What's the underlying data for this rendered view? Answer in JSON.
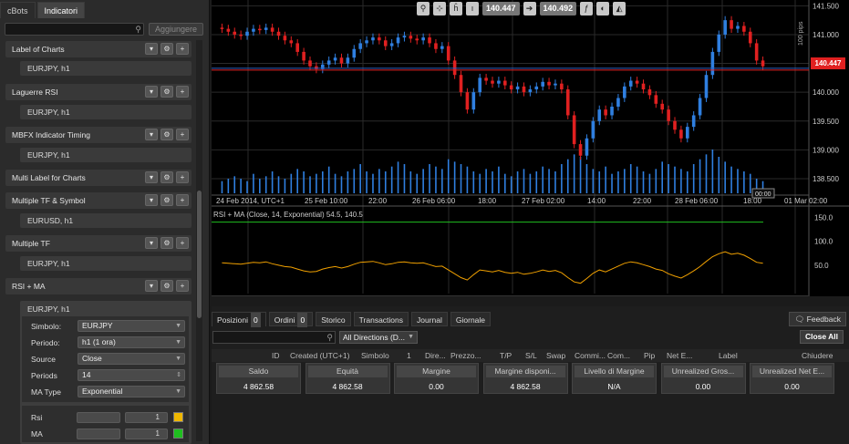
{
  "left_panel": {
    "tabs": [
      "cBots",
      "Indicatori"
    ],
    "add_label": "Aggiungere",
    "indicators": [
      {
        "name": "Label of Charts",
        "sub": "EURJPY, h1"
      },
      {
        "name": "Laguerre RSI",
        "sub": "EURJPY, h1"
      },
      {
        "name": "MBFX  Indicator Timing",
        "sub": "EURJPY, h1"
      },
      {
        "name": "Multi Label for Charts",
        "sub": ""
      },
      {
        "name": "Multiple TF & Symbol",
        "sub": "EURUSD, h1"
      },
      {
        "name": "Multiple TF",
        "sub": "EURJPY, h1"
      },
      {
        "name": "RSI + MA",
        "sub": "EURJPY, h1"
      }
    ],
    "params": {
      "simbolo_label": "Simbolo:",
      "simbolo_value": "EURJPY",
      "periodo_label": "Periodo:",
      "periodo_value": "h1 (1 ora)",
      "source_label": "Source",
      "source_value": "Close",
      "periods_label": "Periods",
      "periods_value": "14",
      "matype_label": "MA Type",
      "matype_value": "Exponential"
    },
    "lines": {
      "rsi_label": "Rsi",
      "rsi_width": "1",
      "rsi_color": "#f0b800",
      "ma_label": "MA",
      "ma_width": "1",
      "ma_color": "#1fbf1f"
    }
  },
  "chart": {
    "bid": "140.447",
    "ask": "140.492",
    "price_badge": "140.447",
    "pips_label": "100 pips",
    "price_ticks": [
      "141.500",
      "141.000",
      "140.500",
      "140.000",
      "139.500",
      "139.000",
      "138.500"
    ],
    "time_labels": [
      "24 Feb 2014, UTC+1",
      "25 Feb 10:00",
      "22:00",
      "26 Feb 06:00",
      "18:00",
      "27 Feb 02:00",
      "14:00",
      "22:00",
      "28 Feb 06:00",
      "18:00",
      "01 Mar 02:00"
    ],
    "cursor_time": "00:00",
    "rsi_title": "RSI + MA (Close, 14, Exponential) 54.5, 140.5",
    "rsi_ticks": [
      "150.0",
      "100.0",
      "50.0"
    ],
    "colors": {
      "bull": "#2f7fe0",
      "bear": "#e02020",
      "rsi": "#f0a000",
      "ma": "#1fbf1f"
    }
  },
  "bottom": {
    "tabs": [
      {
        "label": "Posizioni",
        "count": "0"
      },
      {
        "label": "Ordini",
        "count": "0"
      },
      {
        "label": "Storico",
        "count": ""
      },
      {
        "label": "Transactions",
        "count": ""
      },
      {
        "label": "Journal",
        "count": ""
      },
      {
        "label": "Giornale",
        "count": ""
      }
    ],
    "feedback": "Feedback",
    "direction": "All Directions (D...",
    "close_all": "Close All",
    "columns": [
      "ID",
      "Created (UTC+1)",
      "Simbolo",
      "1",
      "Dire...",
      "Prezzo...",
      "T/P",
      "S/L",
      "Swap",
      "Commi...",
      "Com...",
      "Pip",
      "Net E...",
      "Label",
      "Chiudere"
    ],
    "cards": [
      {
        "title": "Saldo",
        "value": "4 862.58"
      },
      {
        "title": "Equità",
        "value": "4 862.58"
      },
      {
        "title": "Margine",
        "value": "0.00"
      },
      {
        "title": "Margine disponi...",
        "value": "4 862.58"
      },
      {
        "title": "Livello di Margine",
        "value": "N/A"
      },
      {
        "title": "Unrealized Gros...",
        "value": "0.00"
      },
      {
        "title": "Unrealized Net E...",
        "value": "0.00"
      }
    ]
  },
  "chart_data": {
    "type": "candlestick",
    "y_range": [
      138.2,
      141.6
    ],
    "close": [
      141.1,
      141.05,
      141.0,
      140.98,
      141.05,
      141.1,
      141.08,
      141.12,
      141.05,
      140.98,
      140.9,
      140.85,
      140.7,
      140.55,
      140.45,
      140.4,
      140.48,
      140.55,
      140.6,
      140.5,
      140.6,
      140.75,
      140.85,
      140.9,
      140.95,
      140.9,
      140.8,
      140.85,
      140.95,
      140.98,
      140.93,
      140.9,
      140.95,
      140.85,
      140.75,
      140.8,
      140.55,
      140.3,
      140.0,
      139.7,
      140.0,
      140.25,
      140.2,
      140.15,
      140.2,
      140.12,
      140.05,
      140.1,
      140.0,
      140.05,
      140.1,
      140.18,
      140.12,
      140.15,
      140.05,
      139.6,
      139.1,
      138.9,
      139.2,
      139.5,
      139.7,
      139.6,
      139.75,
      139.9,
      140.1,
      140.2,
      140.15,
      140.05,
      139.95,
      139.8,
      139.7,
      139.5,
      139.35,
      139.2,
      139.4,
      139.6,
      139.9,
      140.3,
      140.7,
      141.0,
      141.25,
      141.1,
      141.15,
      141.05,
      140.85,
      140.55,
      140.45
    ],
    "volume": [
      5,
      6,
      7,
      6,
      5,
      8,
      6,
      7,
      9,
      7,
      6,
      8,
      10,
      9,
      7,
      8,
      9,
      11,
      8,
      7,
      9,
      10,
      12,
      9,
      8,
      10,
      9,
      11,
      13,
      12,
      9,
      8,
      10,
      12,
      11,
      10,
      14,
      13,
      12,
      11,
      9,
      8,
      10,
      9,
      11,
      8,
      7,
      9,
      10,
      8,
      9,
      11,
      10,
      9,
      12,
      14,
      16,
      15,
      12,
      10,
      9,
      11,
      8,
      9,
      10,
      12,
      11,
      9,
      8,
      10,
      13,
      12,
      11,
      10,
      9,
      12,
      14,
      16,
      18,
      15,
      13,
      11,
      10,
      9,
      8,
      6,
      5
    ],
    "rsi": [
      55,
      54,
      53,
      52,
      54,
      56,
      55,
      57,
      53,
      50,
      47,
      46,
      42,
      38,
      36,
      37,
      42,
      45,
      47,
      44,
      47,
      52,
      56,
      57,
      58,
      55,
      51,
      53,
      56,
      57,
      55,
      54,
      55,
      51,
      47,
      48,
      40,
      32,
      24,
      19,
      30,
      40,
      38,
      36,
      39,
      35,
      33,
      35,
      31,
      33,
      36,
      40,
      37,
      39,
      34,
      24,
      15,
      12,
      22,
      33,
      40,
      36,
      42,
      48,
      54,
      57,
      55,
      51,
      47,
      42,
      39,
      32,
      27,
      23,
      30,
      38,
      47,
      58,
      68,
      74,
      78,
      73,
      75,
      71,
      64,
      56,
      54
    ],
    "ma": 140.5
  }
}
